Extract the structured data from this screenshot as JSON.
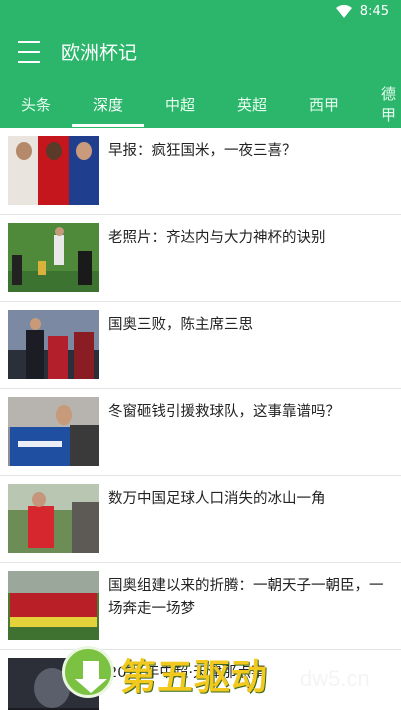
{
  "status": {
    "time": "8:45"
  },
  "app": {
    "title": "欧洲杯记"
  },
  "tabs": [
    {
      "label": "头条"
    },
    {
      "label": "深度"
    },
    {
      "label": "中超"
    },
    {
      "label": "英超"
    },
    {
      "label": "西甲"
    },
    {
      "label": "德甲"
    }
  ],
  "articles": [
    {
      "title": "早报：疯狂国米，一夜三喜？"
    },
    {
      "title": "老照片：齐达内与大力神杯的诀别"
    },
    {
      "title": "国奥三败，陈主席三思"
    },
    {
      "title": "冬窗砸钱引援救球队，这事靠谱吗？"
    },
    {
      "title": "数万中国足球人口消失的冰山一角"
    },
    {
      "title": "国奥组建以来的折腾：一朝天子一朝臣，一场奔走一场梦"
    },
    {
      "title": "2021年中超·天津那点事"
    }
  ],
  "watermark": {
    "text": "第五驱动",
    "domain": "dw5.cn"
  },
  "colors": {
    "accent": "#2bb66b"
  }
}
